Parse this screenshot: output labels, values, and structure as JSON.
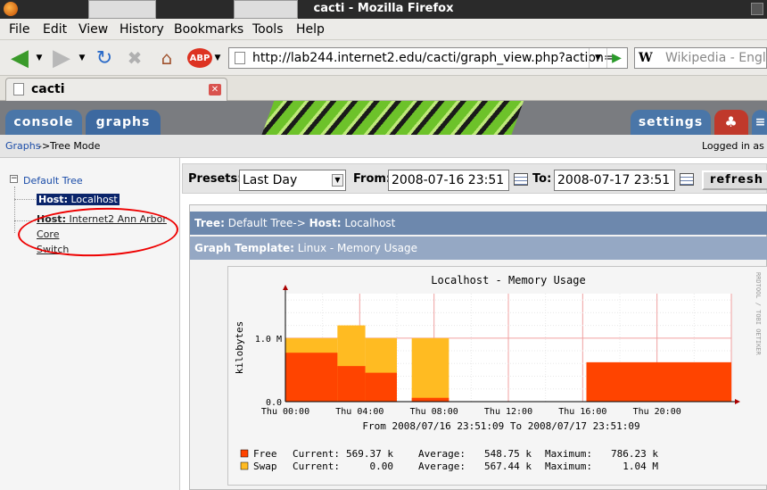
{
  "window": {
    "title": "cacti - Mozilla Firefox"
  },
  "menu": [
    "File",
    "Edit",
    "View",
    "History",
    "Bookmarks",
    "Tools",
    "Help"
  ],
  "nav": {
    "url": "http://lab244.internet2.edu/cacti/graph_view.php?action=",
    "search_placeholder": "Wikipedia - English",
    "search_engine_letter": "W"
  },
  "tab": {
    "title": "cacti"
  },
  "cacti_tabs": {
    "console": "console",
    "graphs": "graphs",
    "settings": "settings"
  },
  "breadcrumb": {
    "link": "Graphs",
    "sep": "->",
    "current": "Tree Mode",
    "logged_in": "Logged in as ac"
  },
  "tree": {
    "root": "Default Tree",
    "items": [
      {
        "prefix": "Host:",
        "name": "Localhost",
        "selected": true
      },
      {
        "prefix": "Host:",
        "name": "Internet2 Ann Arbor Core",
        "name2": "Switch",
        "selected": false
      }
    ]
  },
  "presets": {
    "presets_label": "Presets:",
    "preset_value": "Last Day",
    "from_label": "From:",
    "from_value": "2008-07-16 23:51",
    "to_label": "To:",
    "to_value": "2008-07-17 23:51",
    "refresh_label": "refresh"
  },
  "panel": {
    "tree_label": "Tree:",
    "tree_path": "Default Tree->",
    "host_label": "Host:",
    "host_value": "Localhost",
    "template_label": "Graph Template:",
    "template_value": "Linux - Memory Usage"
  },
  "chart_data": {
    "type": "area",
    "title": "Localhost - Memory Usage",
    "ylabel": "kilobytes",
    "watermark": "RRDTOOL / TOBI OETIKER",
    "y_ticks": [
      "0.0",
      "1.0 M"
    ],
    "x_ticks": [
      "Thu 00:00",
      "Thu 04:00",
      "Thu 08:00",
      "Thu 12:00",
      "Thu 16:00",
      "Thu 20:00"
    ],
    "time_range": "From 2008/07/16 23:51:09 To 2008/07/17 23:51:09",
    "x_hours": [
      0,
      2.8,
      2.8,
      4.3,
      4.3,
      6.0,
      6.8,
      8.8,
      16.2,
      24.0
    ],
    "series": [
      {
        "name": "Free",
        "color": "#ff4400",
        "segments": [
          {
            "from": 0.0,
            "to": 2.8,
            "value": 770000
          },
          {
            "from": 2.8,
            "to": 4.3,
            "value": 560000
          },
          {
            "from": 4.3,
            "to": 6.0,
            "value": 455000
          },
          {
            "from": 6.8,
            "to": 8.8,
            "value": 60000
          },
          {
            "from": 16.2,
            "to": 24.0,
            "value": 620000
          }
        ],
        "stats": {
          "current": "569.37 k",
          "average": "548.75 k",
          "maximum": "786.23 k"
        }
      },
      {
        "name": "Swap",
        "color": "#ffbb22",
        "segments": [
          {
            "from": 0.0,
            "to": 2.8,
            "value": 1000000
          },
          {
            "from": 2.8,
            "to": 4.3,
            "value": 1200000
          },
          {
            "from": 4.3,
            "to": 6.0,
            "value": 1000000
          },
          {
            "from": 6.8,
            "to": 8.8,
            "value": 1000000
          }
        ],
        "stats": {
          "current": "0.00",
          "average": "567.44 k",
          "maximum": "1.04 M"
        }
      }
    ],
    "legend_labels": {
      "current": "Current:",
      "average": "Average:",
      "maximum": "Maximum:"
    },
    "ylim": [
      0,
      1700000
    ],
    "xlim_hours": [
      0,
      24
    ]
  }
}
